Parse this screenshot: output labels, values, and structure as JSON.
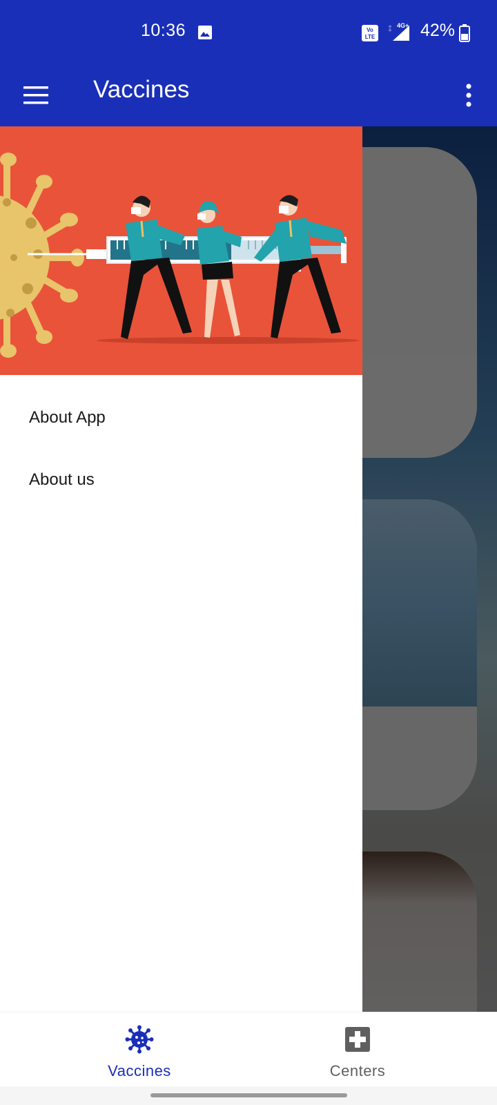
{
  "status_bar": {
    "time": "10:36",
    "battery": "42%",
    "network": "4G+",
    "volte": "Vo LTE"
  },
  "app_bar": {
    "title": "Vaccines",
    "menu_icon": "hamburger-menu-icon",
    "overflow_icon": "more-vert-icon"
  },
  "drawer": {
    "header_illustration": "people-pushing-syringe-at-virus",
    "items": [
      {
        "label": "About App"
      },
      {
        "label": "About us"
      }
    ]
  },
  "bottom_nav": {
    "items": [
      {
        "label": "Vaccines",
        "icon": "virus-icon",
        "selected": true
      },
      {
        "label": "Centers",
        "icon": "medical-cross-icon",
        "selected": false
      }
    ]
  },
  "colors": {
    "primary": "#1a2fb8",
    "drawer_header": "#e9533a",
    "inactive": "#5f5f5f"
  }
}
